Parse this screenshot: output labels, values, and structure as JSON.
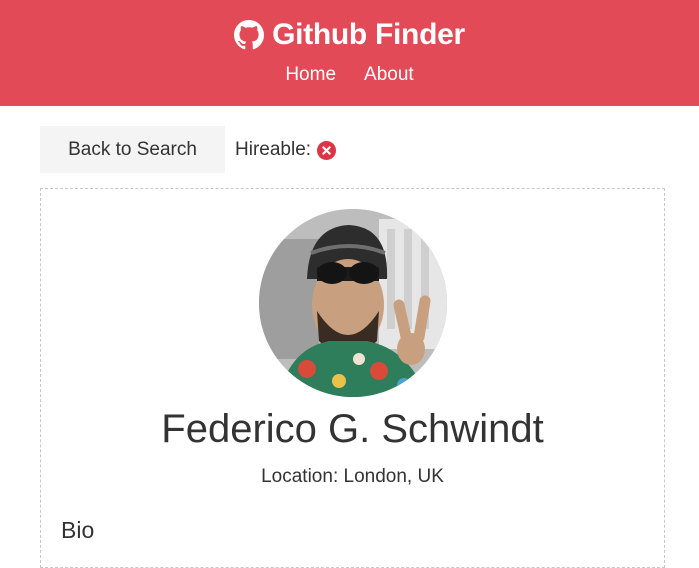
{
  "navbar": {
    "brand_icon": "github-icon",
    "brand_title": "Github Finder",
    "links": [
      "Home",
      "About"
    ],
    "background_color": "#e34a57"
  },
  "actions": {
    "back_label": "Back to Search",
    "hireable_label": "Hireable:",
    "hireable_icon": "times-circle-icon",
    "hireable_status_color": "#dc3545"
  },
  "profile": {
    "avatar": "user-avatar",
    "name": "Federico G. Schwindt",
    "location_label": "Location:",
    "location_value": "London, UK",
    "bio_heading": "Bio"
  }
}
